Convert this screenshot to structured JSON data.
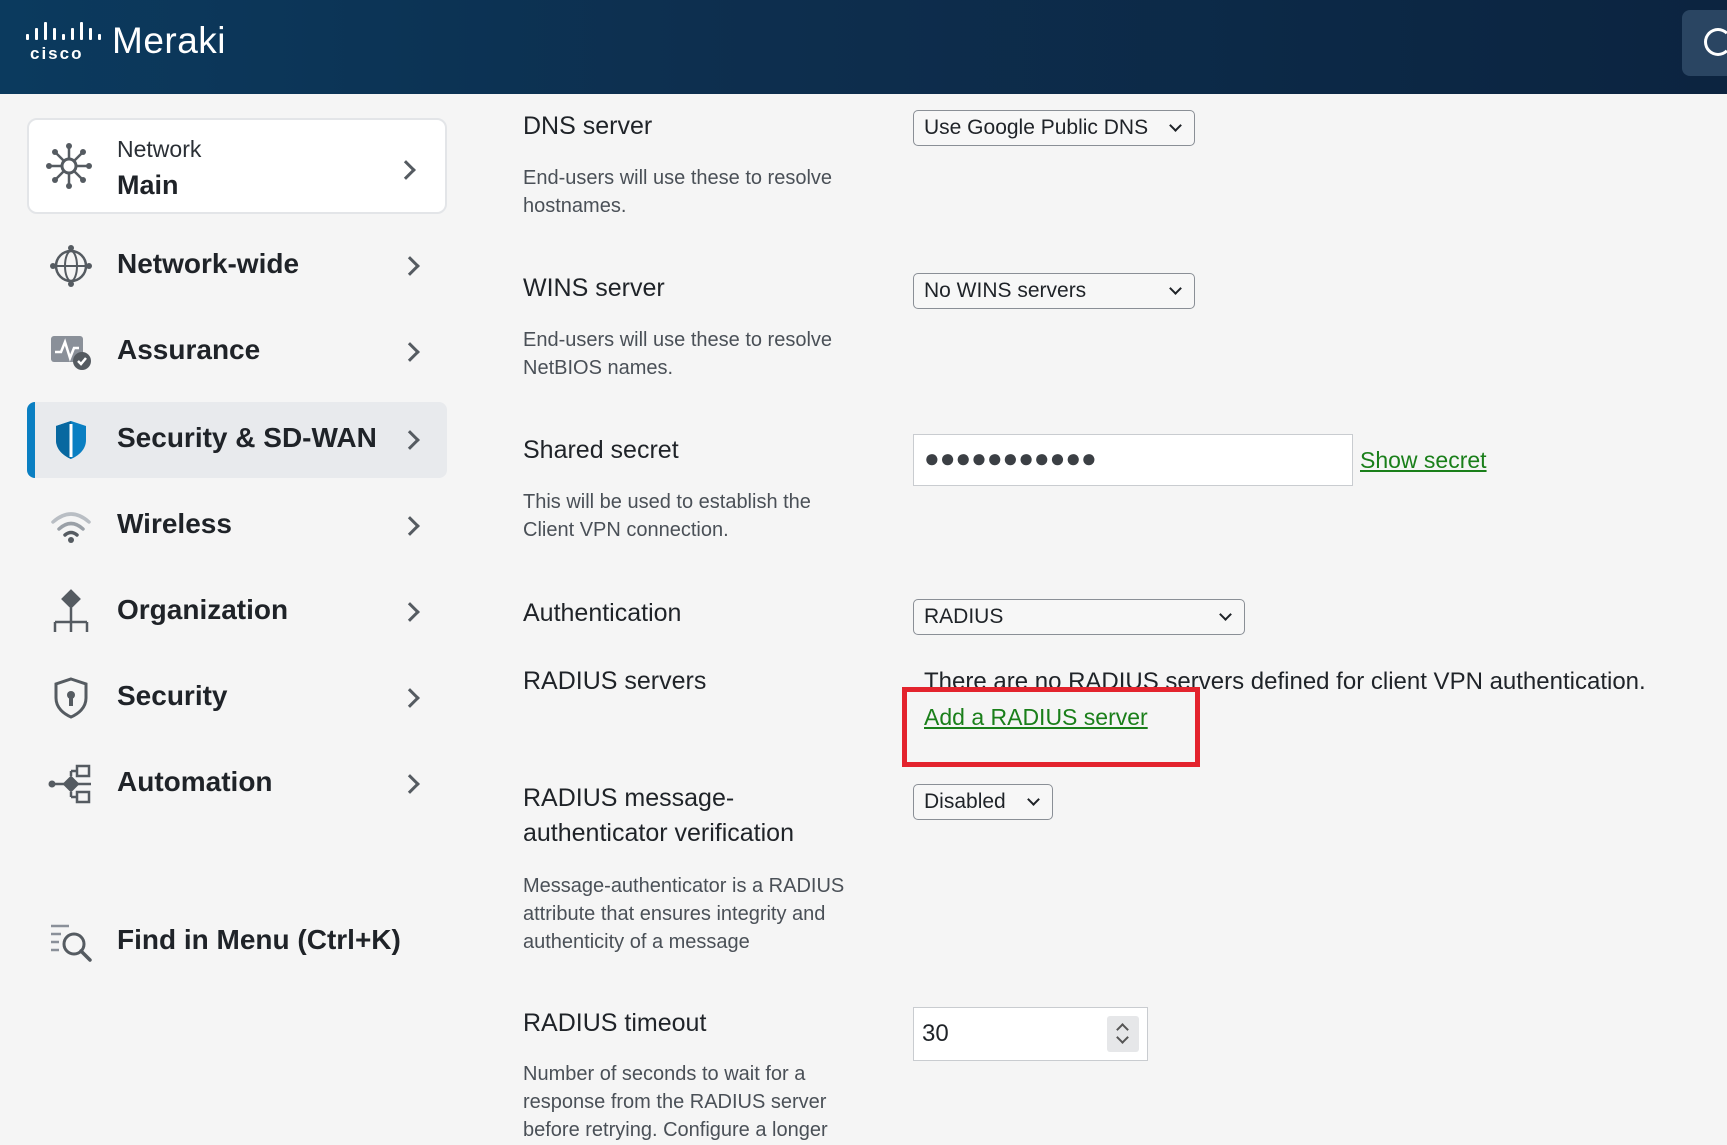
{
  "header": {
    "brand_mark": "cisco",
    "app_name": "Meraki"
  },
  "sidebar": {
    "network_card": {
      "label": "Network",
      "value": "Main",
      "icon": "network-hub-icon"
    },
    "items": [
      {
        "label": "Network-wide",
        "icon": "globe-icon",
        "active": false
      },
      {
        "label": "Assurance",
        "icon": "assurance-icon",
        "active": false
      },
      {
        "label": "Security & SD-WAN",
        "icon": "shield-icon",
        "active": true
      },
      {
        "label": "Wireless",
        "icon": "wifi-icon",
        "active": false
      },
      {
        "label": "Organization",
        "icon": "organization-icon",
        "active": false
      },
      {
        "label": "Security",
        "icon": "security-shield-icon",
        "active": false
      },
      {
        "label": "Automation",
        "icon": "automation-icon",
        "active": false
      }
    ],
    "find_menu": {
      "label": "Find in Menu (Ctrl+K)",
      "icon": "search-menu-icon"
    }
  },
  "form": {
    "dns": {
      "label": "DNS server",
      "help": "End-users will use these to resolve hostnames.",
      "value": "Use Google Public DNS"
    },
    "wins": {
      "label": "WINS server",
      "help": "End-users will use these to resolve NetBIOS names.",
      "value": "No WINS servers"
    },
    "secret": {
      "label": "Shared secret",
      "help": "This will be used to establish the Client VPN connection.",
      "value": "●●●●●●●●●●●",
      "show_link": "Show secret"
    },
    "auth": {
      "label": "Authentication",
      "value": "RADIUS"
    },
    "radius_servers": {
      "label": "RADIUS servers",
      "message": "There are no RADIUS servers defined for client VPN authentication.",
      "add_link": "Add a RADIUS server"
    },
    "radius_msg_auth": {
      "label_line1": "RADIUS message-",
      "label_line2": "authenticator verification",
      "help": "Message-authenticator is a RADIUS attribute that ensures integrity and authenticity of a message",
      "value": "Disabled"
    },
    "radius_timeout": {
      "label": "RADIUS timeout",
      "help": "Number of seconds to wait for a response from the RADIUS server before retrying. Configure a longer",
      "value": "30"
    }
  },
  "colors": {
    "header_bg": "#0d2f4f",
    "accent": "#0a7fc2",
    "link": "#1a7f1a",
    "highlight": "#e3232d"
  }
}
